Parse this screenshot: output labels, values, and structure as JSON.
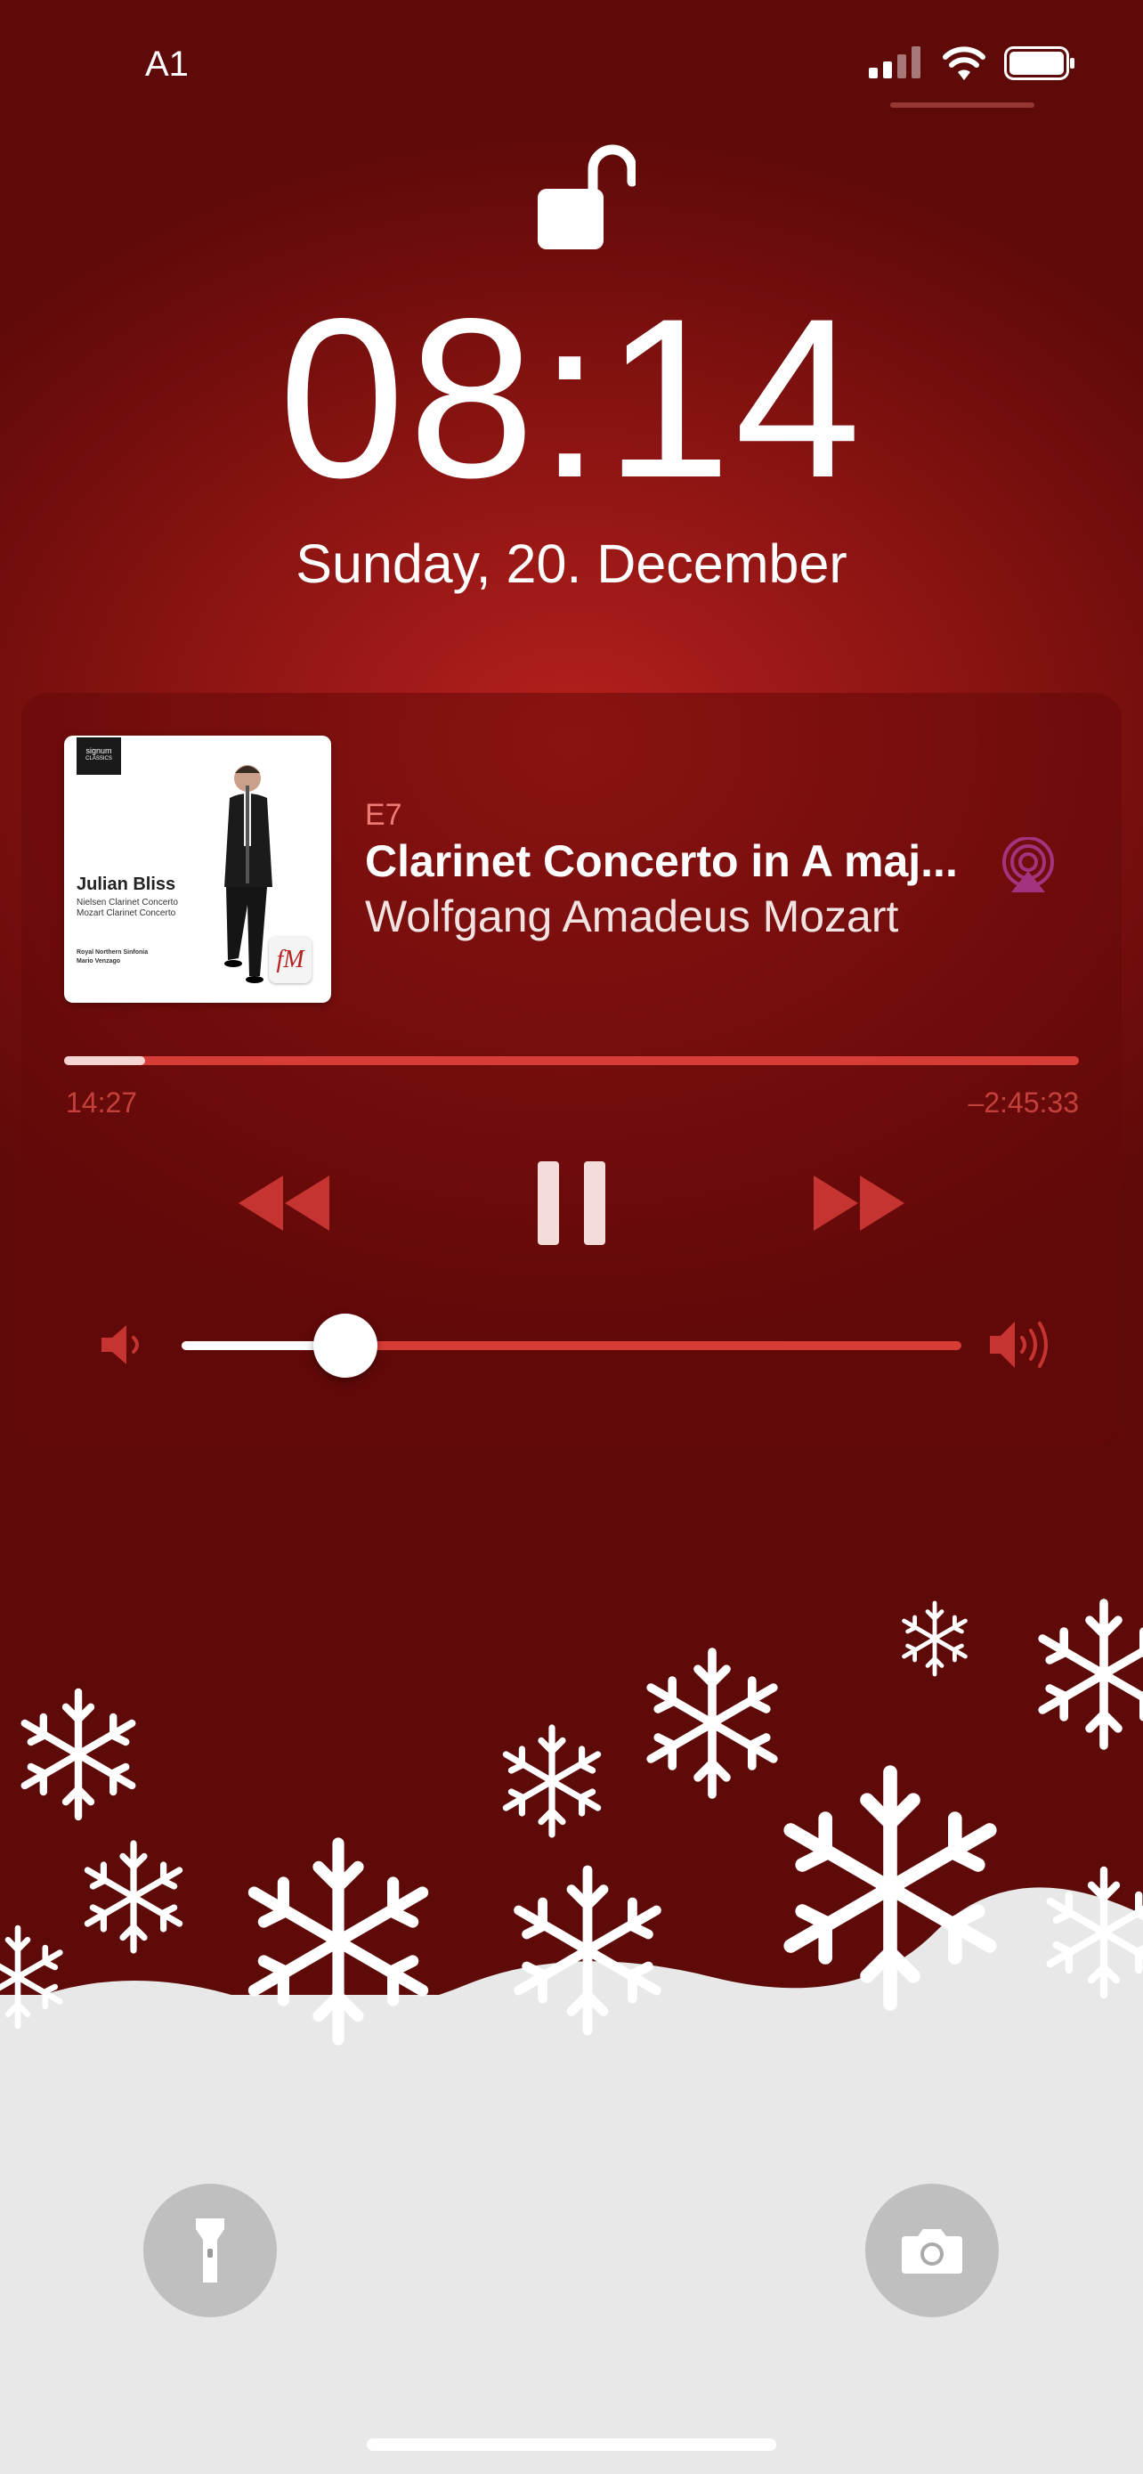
{
  "status_bar": {
    "carrier": "A1",
    "icons": [
      "signal-icon",
      "wifi-icon",
      "battery-icon"
    ]
  },
  "lock_screen": {
    "lock_icon": "unlocked-padlock-icon",
    "time": "08:14",
    "date": "Sunday, 20. December"
  },
  "now_playing": {
    "album_art": {
      "label_top": "signum",
      "label_bottom": "CLASSICS",
      "artist": "Julian Bliss",
      "line1": "Nielsen Clarinet Concerto",
      "line2": "Mozart Clarinet Concerto",
      "ensemble": "Royal Northern Sinfonia",
      "conductor": "Mario Venzago",
      "mark": "fM"
    },
    "source": "E7",
    "title": "Clarinet Concerto in A maj...",
    "artist": "Wolfgang Amadeus Mozart",
    "elapsed": "14:27",
    "remaining": "–2:45:33",
    "progress": 0.08,
    "volume": 0.21,
    "controls": [
      "rewind-icon",
      "pause-icon",
      "fast-forward-icon",
      "airplay-audio-icon"
    ]
  },
  "quick_actions": [
    "flashlight-icon",
    "camera-icon"
  ],
  "colors": {
    "background": "#8e1513",
    "accent_red": "#d83c37",
    "source_label": "#f07b74"
  }
}
